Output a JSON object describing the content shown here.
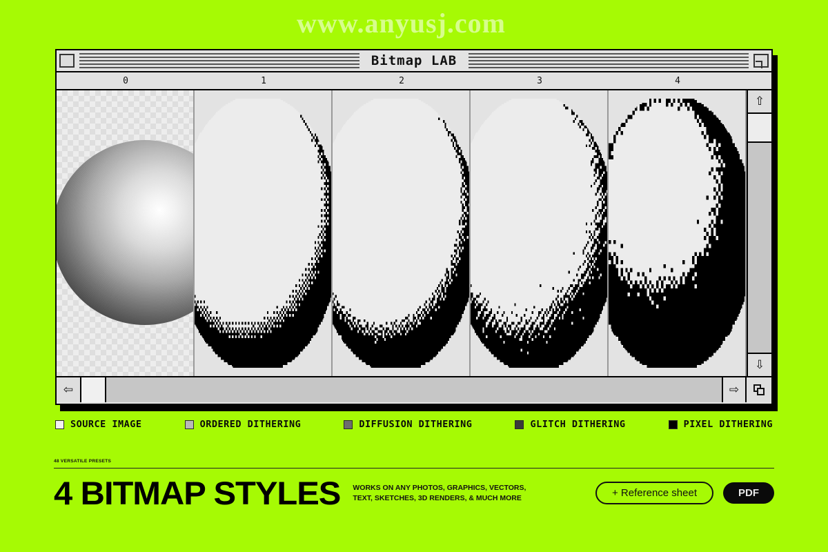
{
  "theme": {
    "background": "#a6fa04",
    "window_bg": "#e3e3e3",
    "ink": "#000000"
  },
  "watermark": {
    "text": "www.anyusj.com"
  },
  "window": {
    "title": "Bitmap LAB",
    "close_icon": "close-box-icon",
    "zoom_icon": "zoom-box-icon",
    "ruler": [
      "0",
      "1",
      "2",
      "3",
      "4"
    ],
    "scrollbar": {
      "up_icon": "arrow-up-icon",
      "down_icon": "arrow-down-icon",
      "left_icon": "arrow-left-icon",
      "right_icon": "arrow-right-icon",
      "resize_icon": "resize-grip-icon"
    }
  },
  "panels": [
    {
      "index": "0",
      "style": "source",
      "label": "SOURCE IMAGE"
    },
    {
      "index": "1",
      "style": "ordered",
      "label": "ORDERED DITHERING"
    },
    {
      "index": "2",
      "style": "diffusion",
      "label": "DIFFUSION DITHERING"
    },
    {
      "index": "3",
      "style": "glitch",
      "label": "GLITCH DITHERING"
    },
    {
      "index": "4",
      "style": "pixel",
      "label": "PIXEL DITHERING"
    }
  ],
  "legend": [
    {
      "label": "SOURCE  IMAGE",
      "color": "#f2f2f2"
    },
    {
      "label": "ORDERED  DITHERING",
      "color": "#b8b8b8"
    },
    {
      "label": "DIFFUSION  DITHERING",
      "color": "#6d6d6d"
    },
    {
      "label": "GLITCH  DITHERING",
      "color": "#3a3a3a"
    },
    {
      "label": "PIXEL  DITHERING",
      "color": "#000000"
    }
  ],
  "footer": {
    "eyebrow": "48 VERSATILE PRESETS",
    "title": "4 BITMAP STYLES",
    "subcopy_line1": "WORKS ON ANY PHOTOS, GRAPHICS, VECTORS,",
    "subcopy_line2": "TEXT, SKETCHES, 3D RENDERS, & MUCH MORE",
    "reference_button": "+ Reference sheet",
    "pdf_button": "PDF"
  }
}
